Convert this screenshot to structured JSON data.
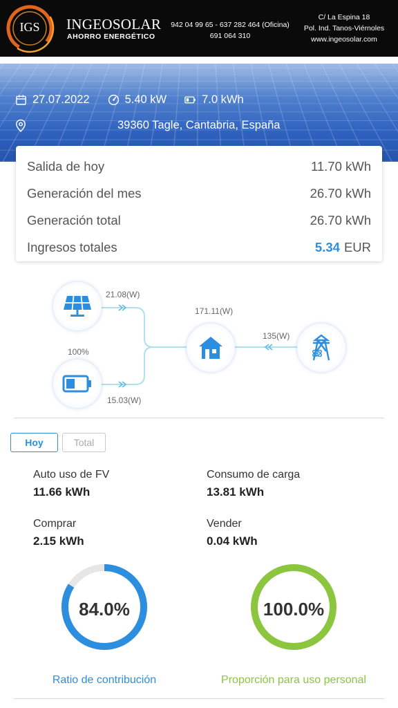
{
  "header": {
    "logo_text": "IGS",
    "brand_name": "INGEOSOLAR",
    "brand_sub": "AHORRO ENERGÉTICO",
    "phone_line1": "942 04 99 65 - 637 282 464 (Oficina)",
    "phone_line2": "691 064 310",
    "address_line1": "C/ La Espina 18",
    "address_line2": "Pol. Ind. Tanos-Viérnoles",
    "website": "www.ingeosolar.com"
  },
  "hero": {
    "date": "27.07.2022",
    "power": "5.40 kW",
    "battery": "7.0 kWh",
    "location": "39360 Tagle, Cantabria, España"
  },
  "summary": {
    "rows": [
      {
        "label": "Salida de hoy",
        "value": "11.70 kWh"
      },
      {
        "label": "Generación del mes",
        "value": "26.70 kWh"
      },
      {
        "label": "Generación total",
        "value": "26.70 kWh"
      }
    ],
    "income_label": "Ingresos totales",
    "income_value": "5.34",
    "income_unit": "EUR"
  },
  "flow": {
    "solar_power": "21.08(W)",
    "battery_soc": "100%",
    "battery_power": "15.03(W)",
    "home_power": "171.11(W)",
    "grid_power": "135(W)"
  },
  "tabs": {
    "today": "Hoy",
    "total": "Total"
  },
  "stats": {
    "self_use_label": "Auto uso de FV",
    "self_use_value": "11.66 kWh",
    "load_label": "Consumo de carga",
    "load_value": "13.81 kWh",
    "buy_label": "Comprar",
    "buy_value": "2.15 kWh",
    "sell_label": "Vender",
    "sell_value": "0.04 kWh"
  },
  "rings": {
    "contribution_value": "84.0%",
    "contribution_fraction": 0.84,
    "contribution_label": "Ratio de contribución",
    "contribution_color": "#2d8ee0",
    "personal_value": "100.0%",
    "personal_fraction": 1.0,
    "personal_label": "Proporción para uso personal",
    "personal_color": "#8cc63f"
  }
}
